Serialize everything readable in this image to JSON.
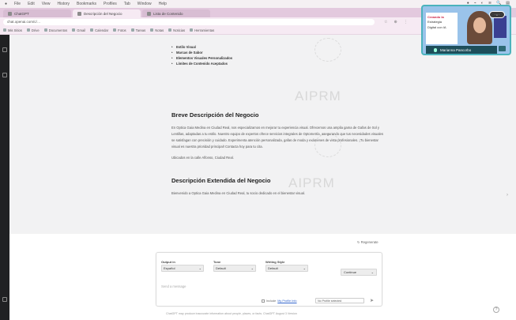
{
  "menubar": {
    "items": [
      "●",
      "File",
      "Edit",
      "View",
      "History",
      "Bookmarks",
      "Profiles",
      "Tab",
      "Window",
      "Help"
    ],
    "status": [
      "●",
      "⌁",
      "◐",
      "≋",
      "🔍",
      "▤"
    ]
  },
  "tabs": [
    {
      "label": "ChatGPT",
      "active": false
    },
    {
      "label": "Descripción del Negocio",
      "active": true
    },
    {
      "label": "Lista de Contenido",
      "active": false
    }
  ],
  "address": {
    "url": "chat.openai.com/c/…",
    "icons": [
      "☆",
      "⊕",
      "⋮"
    ]
  },
  "bookmarks": [
    "Mis Sitios",
    "Drive",
    "Documentos",
    "Gmail",
    "Calendar",
    "Fotos",
    "Tareas",
    "Notas",
    "Noticias",
    "Herramientas"
  ],
  "content": {
    "bullets": [
      "Estilo Visual",
      "Marcas de Sabor",
      "Elementos Visuales Personalizados",
      "Límites de Contenido Aceptados"
    ],
    "heading1": "Breve Descripción del Negocio",
    "para1": "En Optica Gaia Medina en Ciudad Real, nos especializamos en mejorar tu experiencia visual. Ofrecemos una amplia gama de Gafas de Sol y Lentillas, adaptadas a tu estilo. Nuestro equipo de expertos ofrece servicios integrales de Optometría, asegurando que tus necesidades visuales se satisfagan con precisión y cuidado. Experimenta atención personalizada, gafas de moda y exámenes de vista profesionales. ¡Tu bienestar visual es nuestra prioridad principal! Contacta hoy para tu cita.",
    "para2": "Ubicados en la calle Alfonso, Ciudad Real.",
    "heading2": "Descripción Extendida del Negocio",
    "para3": "Bienvenido a Optica Gaia Medina en Ciudad Real, tu socio dedicado en el bienestar visual."
  },
  "watermark": "AIPRM",
  "regenerate_label": "↻ Regenerate",
  "composer": {
    "fields": [
      {
        "label": "Output in",
        "value": "Español"
      },
      {
        "label": "Tone",
        "value": "Default"
      },
      {
        "label": "Writing Style",
        "value": "Default"
      }
    ],
    "continue_label": "Continue",
    "message_placeholder": "Send a message",
    "include_label": "Include",
    "include_link": "My Profile Info",
    "model_label": "No Profile selected",
    "send_icon": "➤"
  },
  "footer": "ChatGPT may produce inaccurate information about people, places, or facts. ChatGPT August 3 Version",
  "help_label": "?",
  "video": {
    "speaker": "Marianna Pancorbo",
    "badge": "· • ·",
    "slide_title": "Creando la",
    "slide_lines": [
      "Estrategia",
      "Digital con IA"
    ]
  }
}
